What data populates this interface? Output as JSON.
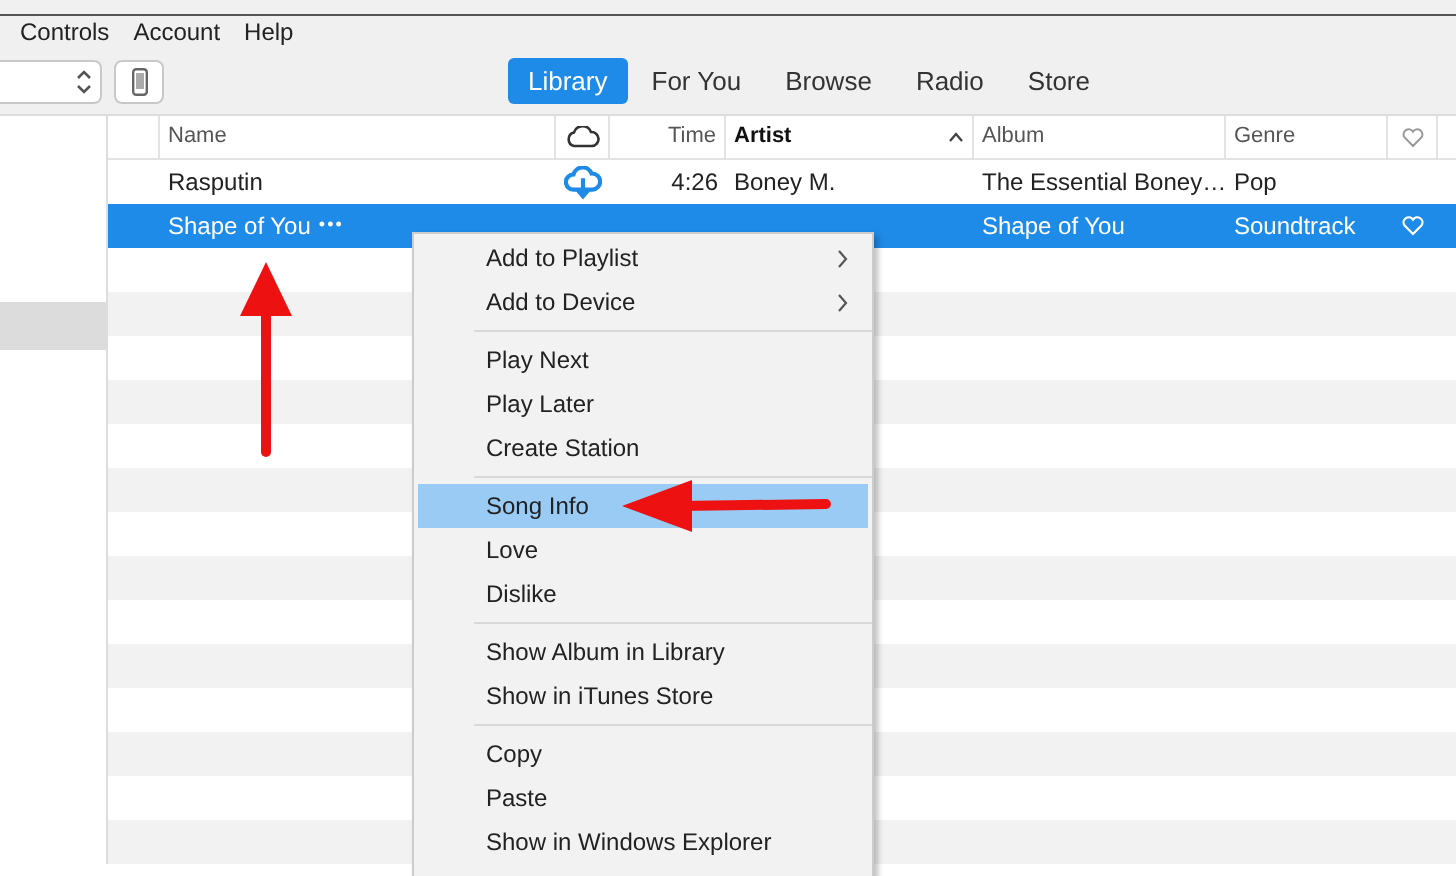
{
  "menu_bar": [
    "Controls",
    "Account",
    "Help"
  ],
  "tabs": [
    {
      "label": "Library",
      "selected": true
    },
    {
      "label": "For You",
      "selected": false
    },
    {
      "label": "Browse",
      "selected": false
    },
    {
      "label": "Radio",
      "selected": false
    },
    {
      "label": "Store",
      "selected": false
    }
  ],
  "table": {
    "columns": [
      {
        "kind": "text",
        "label": "Name",
        "sorted": false
      },
      {
        "kind": "cloud"
      },
      {
        "kind": "text",
        "label": "Time",
        "sorted": false
      },
      {
        "kind": "text",
        "label": "Artist",
        "sorted": true
      },
      {
        "kind": "text",
        "label": "Album",
        "sorted": false
      },
      {
        "kind": "text",
        "label": "Genre",
        "sorted": false
      },
      {
        "kind": "heart"
      }
    ],
    "rows": [
      {
        "name": "Rasputin",
        "cloud_download": true,
        "time": "4:26",
        "artist": "Boney M.",
        "album": "The Essential Boney…",
        "genre": "Pop",
        "heart": false,
        "selected": false
      },
      {
        "name": "Shape of You",
        "more": "•••",
        "cloud_download": false,
        "album": "Shape of You",
        "genre": "Soundtrack",
        "heart": true,
        "selected": true
      }
    ]
  },
  "context_menu": {
    "groups": [
      [
        {
          "label": "Add to Playlist",
          "submenu": true,
          "selected": false
        },
        {
          "label": "Add to Device",
          "submenu": true,
          "selected": false
        }
      ],
      [
        {
          "label": "Play Next",
          "submenu": false,
          "selected": false
        },
        {
          "label": "Play Later",
          "submenu": false,
          "selected": false
        },
        {
          "label": "Create Station",
          "submenu": false,
          "selected": false
        }
      ],
      [
        {
          "label": "Song Info",
          "submenu": false,
          "selected": true
        },
        {
          "label": "Love",
          "submenu": false,
          "selected": false
        },
        {
          "label": "Dislike",
          "submenu": false,
          "selected": false
        }
      ],
      [
        {
          "label": "Show Album in Library",
          "submenu": false,
          "selected": false
        },
        {
          "label": "Show in iTunes Store",
          "submenu": false,
          "selected": false
        }
      ],
      [
        {
          "label": "Copy",
          "submenu": false,
          "selected": false
        },
        {
          "label": "Paste",
          "submenu": false,
          "selected": false
        },
        {
          "label": "Show in Windows Explorer",
          "submenu": false,
          "selected": false
        }
      ]
    ]
  }
}
